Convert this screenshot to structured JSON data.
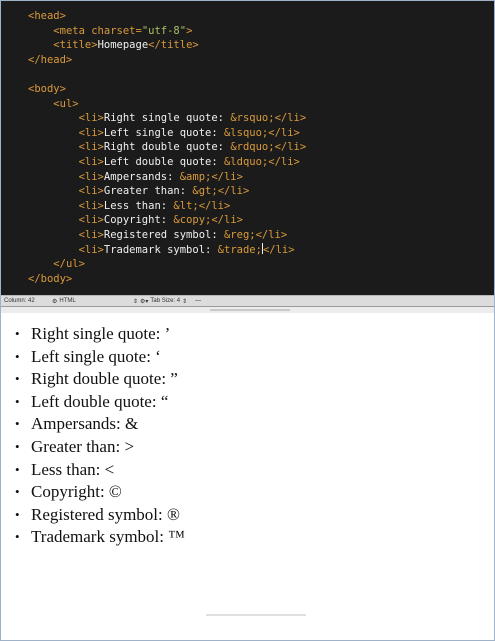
{
  "editor": {
    "lines": [
      {
        "indent": 0,
        "parts": [
          {
            "c": "tag",
            "t": "<head>"
          }
        ]
      },
      {
        "indent": 1,
        "parts": [
          {
            "c": "tag",
            "t": "<meta charset="
          },
          {
            "c": "str",
            "t": "\"utf-8\""
          },
          {
            "c": "tag",
            "t": ">"
          }
        ]
      },
      {
        "indent": 1,
        "parts": [
          {
            "c": "tag",
            "t": "<title>"
          },
          {
            "c": "txt",
            "t": "Homepage"
          },
          {
            "c": "tag",
            "t": "</title>"
          }
        ]
      },
      {
        "indent": 0,
        "parts": [
          {
            "c": "tag",
            "t": "</head>"
          }
        ]
      },
      {
        "indent": 0,
        "parts": []
      },
      {
        "indent": 0,
        "parts": [
          {
            "c": "tag",
            "t": "<body>"
          }
        ]
      },
      {
        "indent": 1,
        "parts": [
          {
            "c": "tag",
            "t": "<ul>"
          }
        ]
      },
      {
        "indent": 2,
        "parts": [
          {
            "c": "tag",
            "t": "<li>"
          },
          {
            "c": "txt",
            "t": "Right single quote: "
          },
          {
            "c": "ent",
            "t": "&rsquo;"
          },
          {
            "c": "tag",
            "t": "</li>"
          }
        ]
      },
      {
        "indent": 2,
        "parts": [
          {
            "c": "tag",
            "t": "<li>"
          },
          {
            "c": "txt",
            "t": "Left single quote: "
          },
          {
            "c": "ent",
            "t": "&lsquo;"
          },
          {
            "c": "tag",
            "t": "</li>"
          }
        ]
      },
      {
        "indent": 2,
        "parts": [
          {
            "c": "tag",
            "t": "<li>"
          },
          {
            "c": "txt",
            "t": "Right double quote: "
          },
          {
            "c": "ent",
            "t": "&rdquo;"
          },
          {
            "c": "tag",
            "t": "</li>"
          }
        ]
      },
      {
        "indent": 2,
        "parts": [
          {
            "c": "tag",
            "t": "<li>"
          },
          {
            "c": "txt",
            "t": "Left double quote: "
          },
          {
            "c": "ent",
            "t": "&ldquo;"
          },
          {
            "c": "tag",
            "t": "</li>"
          }
        ]
      },
      {
        "indent": 2,
        "parts": [
          {
            "c": "tag",
            "t": "<li>"
          },
          {
            "c": "txt",
            "t": "Ampersands: "
          },
          {
            "c": "ent",
            "t": "&amp;"
          },
          {
            "c": "tag",
            "t": "</li>"
          }
        ]
      },
      {
        "indent": 2,
        "parts": [
          {
            "c": "tag",
            "t": "<li>"
          },
          {
            "c": "txt",
            "t": "Greater than: "
          },
          {
            "c": "ent",
            "t": "&gt;"
          },
          {
            "c": "tag",
            "t": "</li>"
          }
        ]
      },
      {
        "indent": 2,
        "parts": [
          {
            "c": "tag",
            "t": "<li>"
          },
          {
            "c": "txt",
            "t": "Less than: "
          },
          {
            "c": "ent",
            "t": "&lt;"
          },
          {
            "c": "tag",
            "t": "</li>"
          }
        ]
      },
      {
        "indent": 2,
        "parts": [
          {
            "c": "tag",
            "t": "<li>"
          },
          {
            "c": "txt",
            "t": "Copyright: "
          },
          {
            "c": "ent",
            "t": "&copy;"
          },
          {
            "c": "tag",
            "t": "</li>"
          }
        ]
      },
      {
        "indent": 2,
        "parts": [
          {
            "c": "tag",
            "t": "<li>"
          },
          {
            "c": "txt",
            "t": "Registered symbol: "
          },
          {
            "c": "ent",
            "t": "&reg;"
          },
          {
            "c": "tag",
            "t": "</li>"
          }
        ]
      },
      {
        "indent": 2,
        "parts": [
          {
            "c": "tag",
            "t": "<li>"
          },
          {
            "c": "txt",
            "t": "Trademark symbol: "
          },
          {
            "c": "ent",
            "t": "&trade;"
          },
          {
            "c": "cursor",
            "t": ""
          },
          {
            "c": "tag",
            "t": "</li>"
          }
        ]
      },
      {
        "indent": 1,
        "parts": [
          {
            "c": "tag",
            "t": "</ul>"
          }
        ]
      },
      {
        "indent": 0,
        "parts": [
          {
            "c": "tag",
            "t": "</body>"
          }
        ]
      }
    ]
  },
  "statusbar": {
    "column": "Column: 42",
    "language": "HTML",
    "language_icon": "gear-icon",
    "tab_size": "Tab Size:  4",
    "symbol_menu": "—"
  },
  "preview": {
    "items": [
      "Right single quote: ’",
      "Left single quote: ‘",
      "Right double quote: ”",
      "Left double quote: “",
      "Ampersands: &",
      "Greater than: >",
      "Less than: <",
      "Copyright: ©",
      "Registered symbol: ®",
      "Trademark symbol: ™"
    ]
  }
}
